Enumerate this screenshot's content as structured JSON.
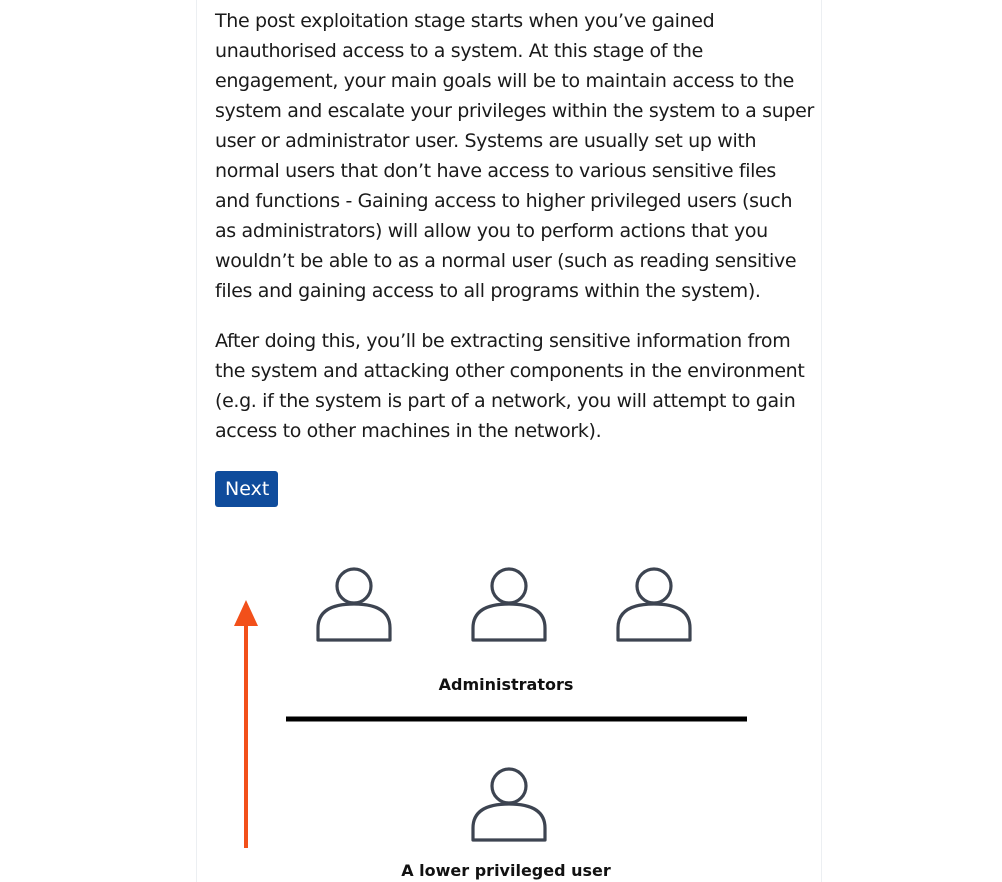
{
  "content": {
    "paragraphs": [
      "The post exploitation stage starts when you’ve gained unauthorised access to a system. At this stage of the engagement, your main goals will be to maintain access to the system and escalate your privileges within the system to a super user or administrator user. Systems are usually set up with normal users that don’t have access to various sensitive files and functions - Gaining access to higher privileged users (such as administrators) will allow you to perform actions that you wouldn’t be able to as a normal user (such as reading sensitive files and gaining access to all programs within the system).",
      "After doing this, you’ll be extracting sensitive information from the system and attacking other components in the environment (e.g. if the system is part of a network, you will attempt to gain access to other machines in the network)."
    ],
    "next_label": "Next"
  },
  "illustration": {
    "admin_label": "Administrators",
    "user_label": "A lower privileged user",
    "arrow_color": "#f2501a",
    "icon_color": "#3d4451",
    "divider_color": "#000000"
  },
  "colors": {
    "button_bg": "#0f4c9c",
    "button_text": "#ffffff"
  }
}
